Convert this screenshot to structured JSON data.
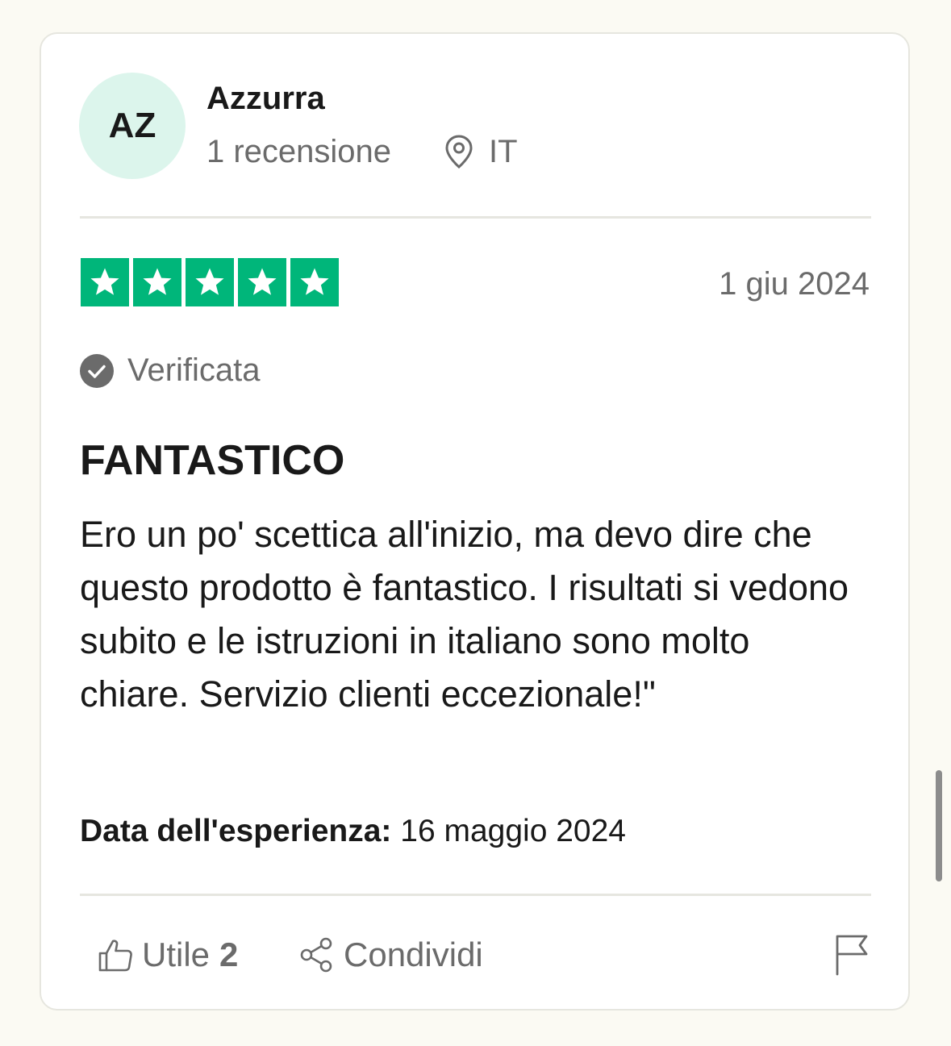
{
  "reviewer": {
    "initials": "AZ",
    "name": "Azzurra",
    "reviews_count": "1 recensione",
    "country": "IT"
  },
  "rating": {
    "stars": 5,
    "max_stars": 5,
    "date": "1 giu 2024",
    "verified_label": "Verificata"
  },
  "review": {
    "title": "FANTASTICO",
    "body": "Ero un po' scettica all'inizio, ma devo dire che questo prodotto è fantastico. I risultati si vedono subito e le istruzioni in italiano sono molto chiare. Servizio clienti eccezionale!\"",
    "experience_label": "Data dell'esperienza:",
    "experience_date": "16 maggio 2024"
  },
  "actions": {
    "useful_label": "Utile",
    "useful_count": "2",
    "share_label": "Condividi"
  },
  "colors": {
    "star_green": "#00b67a",
    "avatar_bg": "#dcf5ec",
    "text_muted": "#6b6b6b",
    "text_main": "#191919"
  },
  "icons": {
    "location": "location-pin-icon",
    "verified": "check-circle-icon",
    "useful": "thumbs-up-icon",
    "share": "share-icon",
    "report": "flag-icon"
  }
}
